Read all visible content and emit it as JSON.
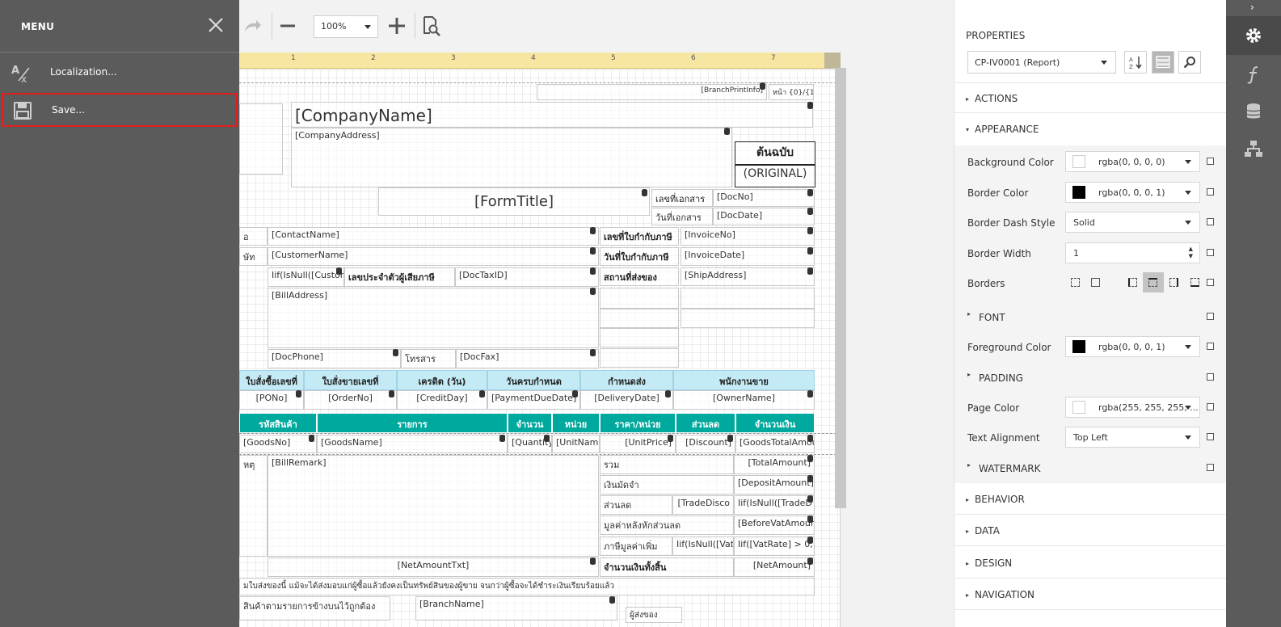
{
  "menu": {
    "title": "MENU",
    "items": [
      {
        "label": "Localization..."
      },
      {
        "label": "Save..."
      }
    ]
  },
  "toolbar": {
    "zoom": "100%"
  },
  "ruler": [
    "1",
    "2",
    "3",
    "4",
    "5",
    "6",
    "7"
  ],
  "report": {
    "branch_print_info": "[BranchPrintInfo]",
    "page_no": "หน้า {0}/{1}",
    "company_name": "[CompanyName]",
    "company_address": "[CompanyAddress]",
    "original_th": "ต้นฉบับ",
    "original_en": "(ORIGINAL)",
    "form_title": "[FormTitle]",
    "doc_no_label": "เลขที่เอกสาร",
    "doc_no": "[DocNo]",
    "doc_date_label": "วันที่เอกสาร",
    "doc_date": "[DocDate]",
    "contact_name": "[ContactName]",
    "customer_name": "[CustomerName]",
    "customer_iif": "Iif(IsNull([Custom",
    "tax_id_label": "เลขประจำตัวผู้เสียภาษี",
    "doc_tax_id": "[DocTaxID]",
    "bill_address": "[BillAddress]",
    "doc_phone": "[DocPhone]",
    "fax_label": "โทรสาร",
    "doc_fax": "[DocFax]",
    "invoice_no_label": "เลขที่ใบกำกับภาษี",
    "invoice_no": "[InvoiceNo]",
    "invoice_date_label": "วันที่ใบกำกับภาษี",
    "invoice_date": "[InvoiceDate]",
    "ship_label": "สถานที่ส่งของ",
    "ship_address": "[ShipAddress]",
    "left_label_1": "อ",
    "left_label_2": "ษัท",
    "blue_headers": [
      "ใบสั่งซื้อเลขที่",
      "ใบสั่งขายเลขที่",
      "เครดิต (วัน)",
      "วันครบกำหนด",
      "กำหนดส่ง",
      "พนักงานขาย"
    ],
    "blue_values": [
      "[PONo]",
      "[OrderNo]",
      "[CreditDay]",
      "[PaymentDueDate]",
      "[DeliveryDate]",
      "[OwnerName]"
    ],
    "teal_headers": [
      "รหัสสินค้า",
      "รายการ",
      "จำนวน",
      "หน่วย",
      "ราคา/หน่วย",
      "ส่วนลด",
      "จำนวนเงิน"
    ],
    "teal_values": [
      "[GoodsNo]",
      "[GoodsName]",
      "[Quantity",
      "[UnitNam",
      "[UnitPrice]",
      "[Discount]",
      "[GoodsTotalAmou"
    ],
    "remark_label": "หตุ",
    "bill_remark": "[BillRemark]",
    "sum_labels": [
      "รวม",
      "เงินมัดจำ",
      "ส่วนลด",
      "มูลค่าหลังหักส่วนลด",
      "ภาษีมูลค่าเพิ่ม",
      "จำนวนเงินทั้งสิ้น"
    ],
    "sum_values": [
      "[TotalAmount]",
      "[DepositAmount]",
      "[TradeDisco",
      "[BeforeVatAmoun",
      "Iif(IsNull([Vat",
      "[NetAmount]"
    ],
    "trade_iif": "Iif(IsNull([TradeD",
    "vat_iif": "Iif([VatRate] > 0,",
    "net_amount_txt": "[NetAmountTxt]",
    "footer_note": "มใบส่งของนี้ แม้จะได้ส่งมอบแก่ผู้ซื้อแล้วยังคงเป็นทรัพย์สินของผู้ขาย จนกว่าผู้ซื้อจะได้ชำระเงินเรียบร้อยแล้ว",
    "footer_goods": "สินค้าตามรายการข้างบนไว้ถูกต้อง",
    "branch_name": "[BranchName]",
    "footer_right": "ผู้ส่งของ"
  },
  "properties": {
    "title": "PROPERTIES",
    "selected_object": "CP-IV0001 (Report)",
    "sections": {
      "actions": "ACTIONS",
      "appearance": "APPEARANCE",
      "behavior": "BEHAVIOR",
      "data": "DATA",
      "design": "DESIGN",
      "navigation": "NAVIGATION"
    },
    "rows": {
      "background_color": {
        "label": "Background Color",
        "value": "rgba(0, 0, 0, 0)",
        "swatch": "#ffffff"
      },
      "border_color": {
        "label": "Border Color",
        "value": "rgba(0, 0, 0, 1)",
        "swatch": "#000000"
      },
      "border_dash_style": {
        "label": "Border Dash Style",
        "value": "Solid"
      },
      "border_width": {
        "label": "Border Width",
        "value": "1"
      },
      "borders": {
        "label": "Borders"
      },
      "font": {
        "label": "FONT"
      },
      "foreground_color": {
        "label": "Foreground Color",
        "value": "rgba(0, 0, 0, 1)",
        "swatch": "#000000"
      },
      "padding": {
        "label": "PADDING"
      },
      "page_color": {
        "label": "Page Color",
        "value": "rgba(255, 255, 255, ...",
        "swatch": "#ffffff"
      },
      "text_alignment": {
        "label": "Text Alignment",
        "value": "Top Left"
      },
      "watermark": {
        "label": "WATERMARK"
      }
    }
  },
  "colors": {
    "menu_bg": "#5b5b5b",
    "highlight": "#e01e1e",
    "teal": "#00a99d",
    "light_blue": "#c4eaf5",
    "ruler": "#f7e6a1"
  },
  "icons": {
    "close": "close-icon",
    "localization": "translate-icon",
    "save": "floppy-disk-icon",
    "redo": "redo-icon",
    "zoom_out": "minus-icon",
    "zoom_in": "plus-icon",
    "preview": "document-search-icon",
    "sort": "sort-az-icon",
    "categorize": "categories-icon",
    "search": "search-icon",
    "properties": "gear-icon",
    "expressions": "function-icon",
    "field_list": "database-icon",
    "explorer": "tree-icon"
  }
}
